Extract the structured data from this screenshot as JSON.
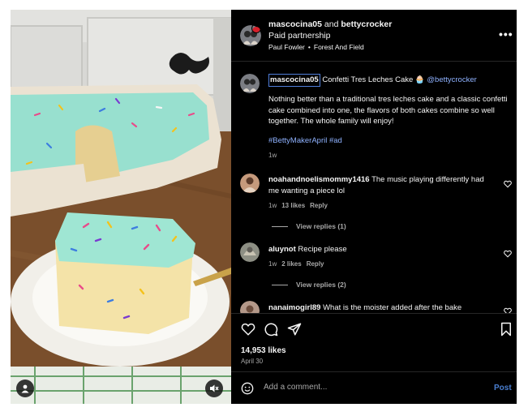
{
  "media": {
    "photo_description_icon": "cake-photo",
    "account_icon": "user-icon",
    "mute_icon": "speaker-muted-icon"
  },
  "header": {
    "account_primary": "mascocina05",
    "and_text": " and ",
    "account_secondary": "bettycrocker",
    "paid_partnership": "Paid partnership",
    "audio_artist": "Paul Fowler",
    "audio_separator": "•",
    "audio_track": "Forest And Field",
    "more_icon": "more-options-icon",
    "more_glyph": "•••"
  },
  "caption": {
    "username": "mascocina05",
    "text_before_mention": " Confetti Tres Leches Cake 🧁 ",
    "mention": "@bettycrocker",
    "body": "Nothing better than a traditional tres leches cake and a classic confetti cake combined into one, the flavors of both cakes combine so well together. The whole family will enjoy!",
    "hashtags": "#BettyMakerApril #ad",
    "age": "1w"
  },
  "comments": [
    {
      "username": "noahandnoelismommy1416",
      "text": "The music playing differently had me wanting a piece lol",
      "age": "1w",
      "likes": "13 likes",
      "reply": "Reply",
      "view_replies": "View replies (1)"
    },
    {
      "username": "aluynot",
      "text": "Recipe please",
      "age": "1w",
      "likes": "2 likes",
      "reply": "Reply",
      "view_replies": "View replies (2)"
    },
    {
      "username": "nanaimogirl89",
      "text": "What is the moister added after the bake"
    }
  ],
  "actions": {
    "like_icon": "heart-icon",
    "comment_icon": "comment-icon",
    "share_icon": "paper-plane-icon",
    "save_icon": "bookmark-icon",
    "likes_count": "14,953 likes",
    "date": "April 30"
  },
  "composer": {
    "emoji_icon": "smiley-icon",
    "placeholder": "Add a comment...",
    "post_label": "Post"
  },
  "colors": {
    "panel_background": "#000000",
    "link_blue": "#8fb2ff",
    "post_button_blue": "#4a7fd1",
    "muted_text": "#a8a8a8"
  }
}
